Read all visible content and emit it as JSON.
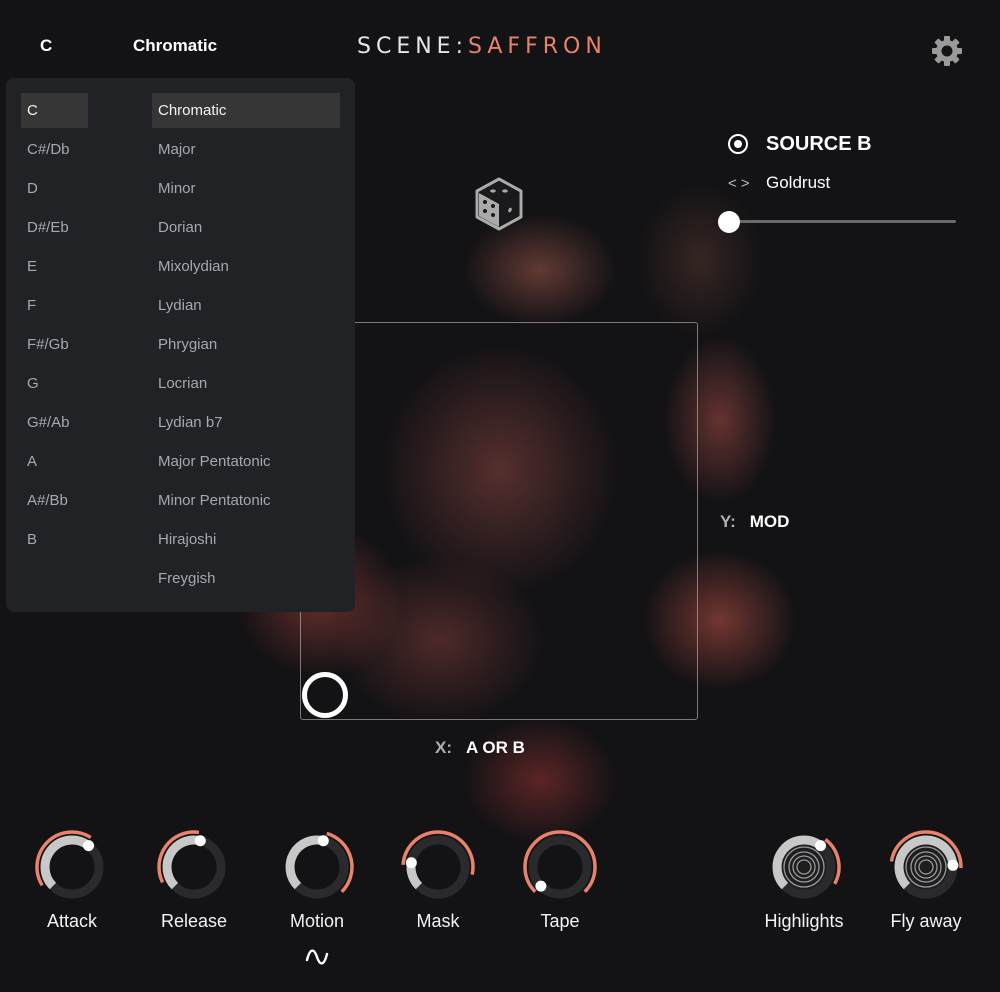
{
  "header": {
    "key": "C",
    "scale": "Chromatic",
    "logo_part1": "SCENE:",
    "logo_part2": "SAFFRON",
    "settings_icon": "gear-icon"
  },
  "colors": {
    "accent": "#e8826b",
    "dropdown_bg": "#202226",
    "selected_bg": "#363636",
    "knob_track": "#2a2a2d",
    "knob_value": "#c8c8c8"
  },
  "dropdown": {
    "keys": [
      "C",
      "C#/Db",
      "D",
      "D#/Eb",
      "E",
      "F",
      "F#/Gb",
      "G",
      "G#/Ab",
      "A",
      "A#/Bb",
      "B"
    ],
    "selected_key": "C",
    "scales": [
      "Chromatic",
      "Major",
      "Minor",
      "Dorian",
      "Mixolydian",
      "Lydian",
      "Phrygian",
      "Locrian",
      "Lydian b7",
      "Major Pentatonic",
      "Minor Pentatonic",
      "Hirajoshi",
      "Freygish"
    ],
    "selected_scale": "Chromatic"
  },
  "source": {
    "title": "SOURCE B",
    "prev_icon": "<",
    "next_icon": ">",
    "preset": "Goldrust",
    "slider_value": 0.0
  },
  "xypad": {
    "x_key": "X:",
    "x_value": "A OR B",
    "y_key": "Y:",
    "y_value": "MOD",
    "handle_x": 0.0,
    "handle_y": 0.0
  },
  "knobs": [
    {
      "label": "Attack",
      "value": 0.64,
      "mod_start": 0.05,
      "mod_end": 0.62,
      "rings": false
    },
    {
      "label": "Release",
      "value": 0.55,
      "mod_start": 0.07,
      "mod_end": 0.53,
      "rings": false
    },
    {
      "label": "Motion",
      "value": 0.55,
      "mod_start": 0.56,
      "mod_end": 1.0,
      "rings": false
    },
    {
      "label": "Mask",
      "value": 0.2,
      "mod_start": 0.18,
      "mod_end": 0.88,
      "rings": false
    },
    {
      "label": "Tape",
      "value": 0.0,
      "mod_start": 0.0,
      "mod_end": 1.0,
      "rings": false
    },
    {
      "label": "Highlights",
      "value": 0.64,
      "mod_start": 0.64,
      "mod_end": 0.94,
      "rings": true
    },
    {
      "label": "Fly away",
      "value": 0.82,
      "mod_start": 0.2,
      "mod_end": 0.84,
      "rings": true
    }
  ],
  "motion_lfo_icon": "sine-wave-icon"
}
